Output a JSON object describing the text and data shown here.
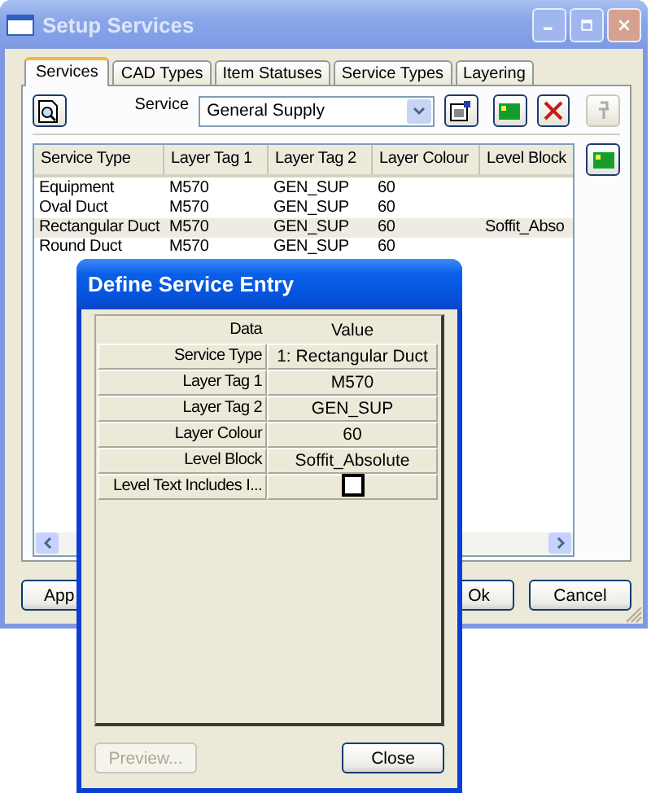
{
  "window": {
    "title": "Setup Services"
  },
  "tabs": [
    {
      "label": "Services",
      "selected": true
    },
    {
      "label": "CAD Types",
      "selected": false
    },
    {
      "label": "Item Statuses",
      "selected": false
    },
    {
      "label": "Service Types",
      "selected": false
    },
    {
      "label": "Layering",
      "selected": false
    }
  ],
  "toolbar": {
    "service_label": "Service",
    "service_value": "General Supply"
  },
  "list": {
    "columns": [
      "Service Type",
      "Layer Tag 1",
      "Layer Tag 2",
      "Layer Colour",
      "Level Block"
    ],
    "rows": [
      {
        "cells": [
          "Equipment",
          "M570",
          "GEN_SUP",
          "60"
        ],
        "selected": false
      },
      {
        "cells": [
          "Oval Duct",
          "M570",
          "GEN_SUP",
          "60"
        ],
        "selected": false
      },
      {
        "cells": [
          "Rectangular Duct",
          "M570",
          "GEN_SUP",
          "60",
          "Soffit_Abso"
        ],
        "selected": true
      },
      {
        "cells": [
          "Round Duct",
          "M570",
          "GEN_SUP",
          "60"
        ],
        "selected": false
      }
    ]
  },
  "buttons": [
    {
      "kind": "apply",
      "label": "App"
    },
    {
      "kind": "ok",
      "label": "Ok"
    },
    {
      "kind": "cancel",
      "label": "Cancel"
    }
  ],
  "dialog": {
    "title": "Define Service Entry",
    "columns": [
      "Data",
      "Value"
    ],
    "rows": [
      {
        "kind": "text",
        "label": "Service Type",
        "value": "1: Rectangular Duct"
      },
      {
        "kind": "text",
        "label": "Layer Tag 1",
        "value": "M570"
      },
      {
        "kind": "text",
        "label": "Layer Tag 2",
        "value": "GEN_SUP"
      },
      {
        "kind": "text",
        "label": "Layer Colour",
        "value": "60"
      },
      {
        "kind": "text",
        "label": "Level Block",
        "value": "Soffit_Absolute"
      },
      {
        "kind": "checkbox",
        "label": "Level Text Includes I...",
        "checked": false
      }
    ],
    "buttons": [
      {
        "label": "Preview...",
        "disabled": true
      },
      {
        "label": "Close",
        "disabled": false
      }
    ]
  }
}
